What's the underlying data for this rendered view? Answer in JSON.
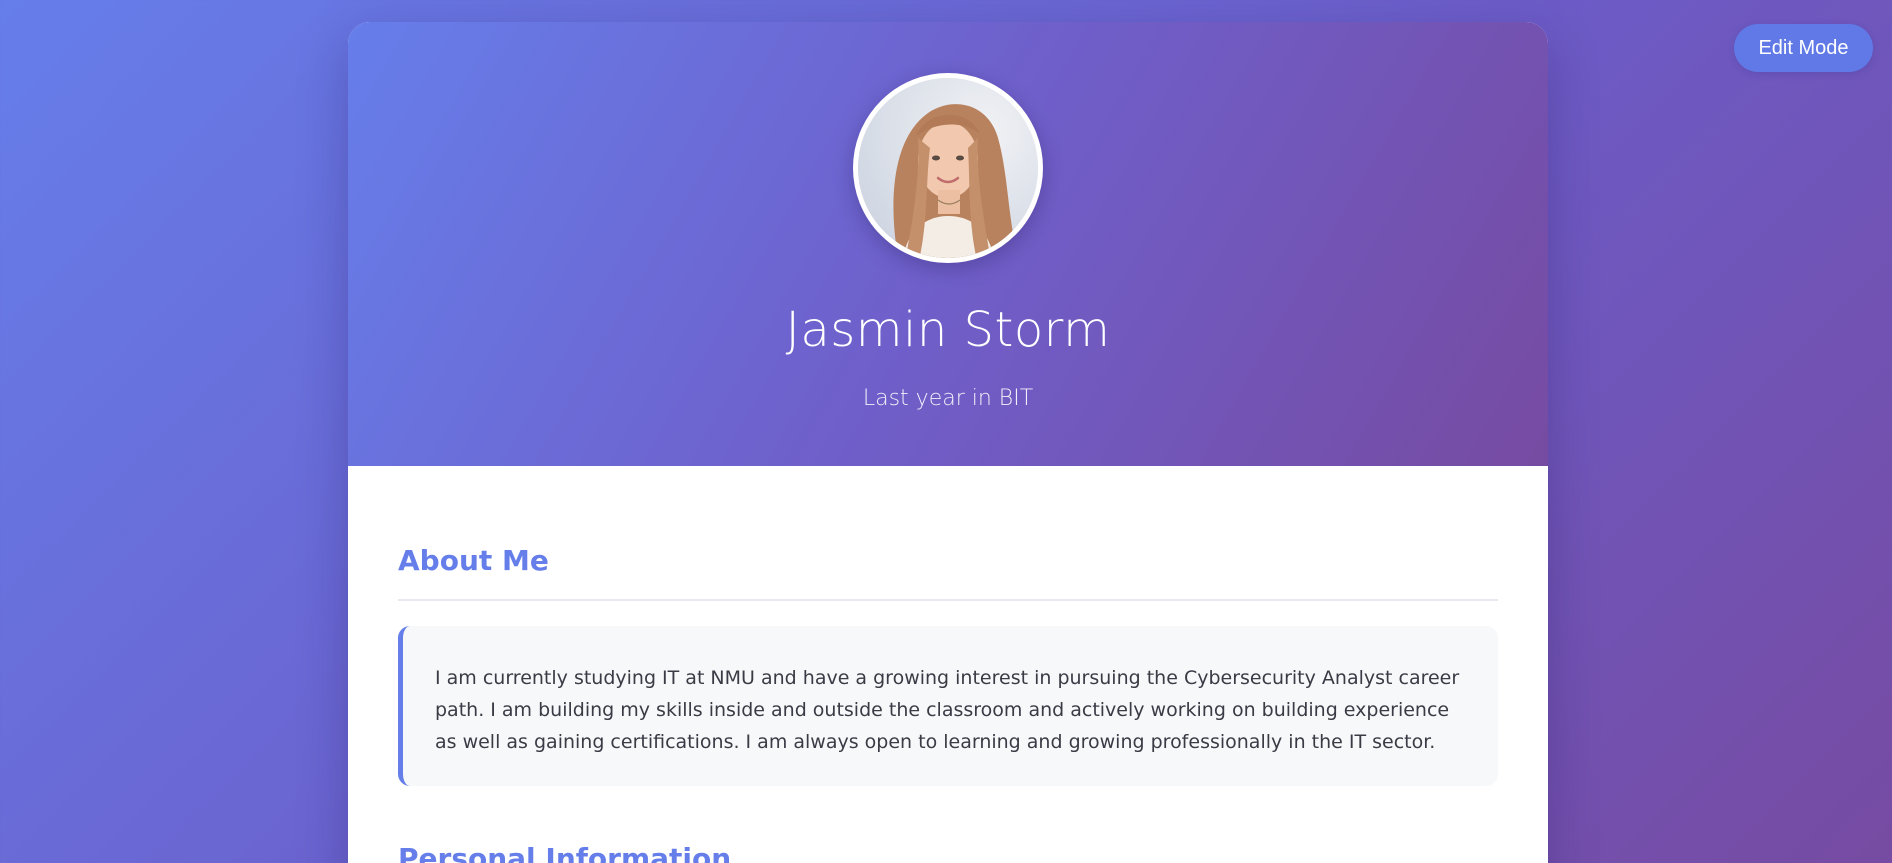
{
  "toolbar": {
    "edit_mode_label": "Edit Mode"
  },
  "profile": {
    "name": "Jasmin Storm",
    "subtitle": "Last year in BIT",
    "avatar_icon": "profile-photo"
  },
  "sections": {
    "about": {
      "title": "About Me",
      "text": "I am currently studying IT at NMU and have a growing interest in pursuing the Cybersecurity Analyst career path. I am building my skills inside and outside the classroom and actively working on building experience as well as gaining certifications. I am always open to learning and growing professionally in the IT sector."
    },
    "personal": {
      "title": "Personal Information"
    }
  },
  "colors": {
    "accent": "#667eea",
    "gradient_start": "#667eea",
    "gradient_end": "#764ba2",
    "text": "#3b3b46",
    "panel": "#f7f8fa"
  }
}
